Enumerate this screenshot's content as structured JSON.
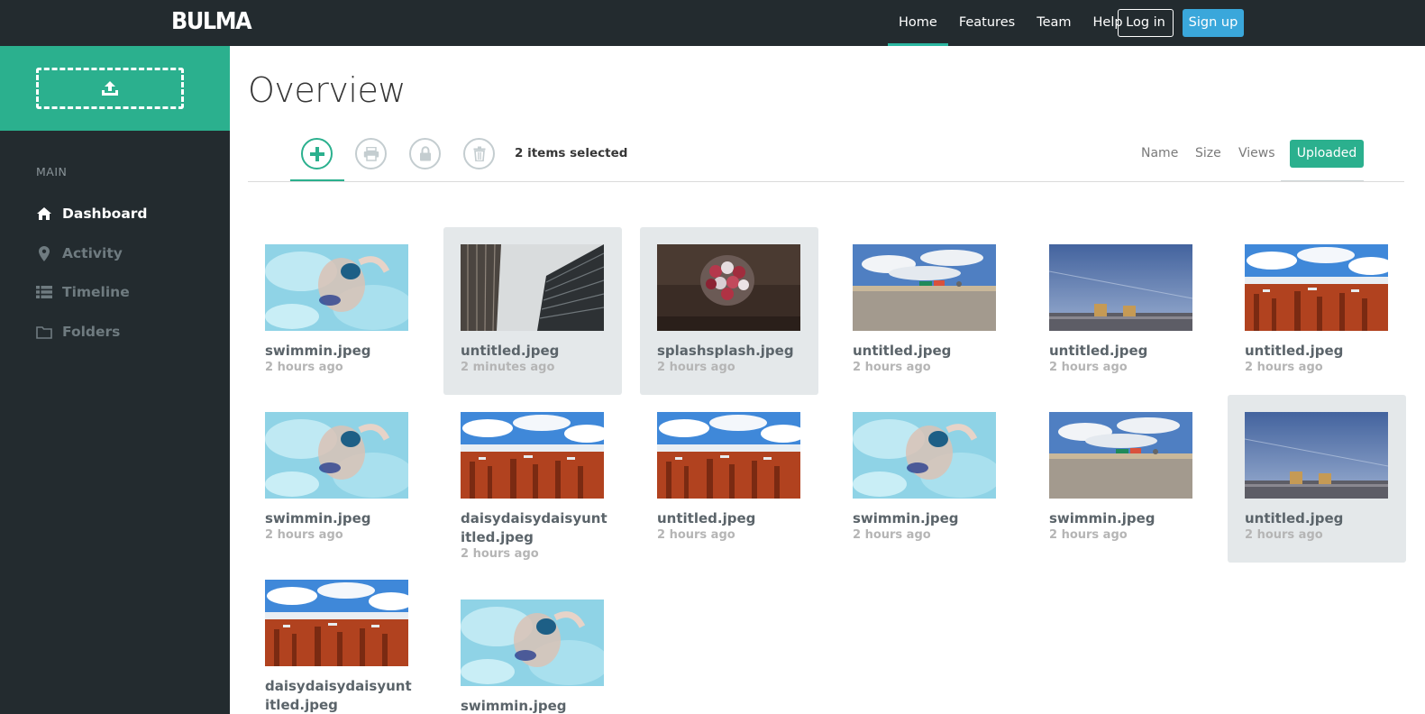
{
  "navbar": {
    "brand": "BULMA",
    "links": [
      "Home",
      "Features",
      "Team",
      "Help"
    ],
    "login_label": "Log in",
    "signup_label": "Sign up"
  },
  "sidebar": {
    "upload_icon": "upload-icon",
    "section_label": "MAIN",
    "items": [
      {
        "label": "Dashboard",
        "icon": "home-icon"
      },
      {
        "label": "Activity",
        "icon": "map-marker-icon"
      },
      {
        "label": "Timeline",
        "icon": "list-icon"
      },
      {
        "label": "Folders",
        "icon": "folder-icon"
      }
    ]
  },
  "main": {
    "title": "Overview",
    "toolbar": {
      "actions": [
        "plus-icon",
        "print-icon",
        "lock-icon",
        "trash-icon"
      ],
      "selected_text": "2 items selected"
    },
    "sort": {
      "options": [
        "Name",
        "Size",
        "Views"
      ],
      "active": "Uploaded"
    },
    "files": [
      {
        "name": "swimmin.jpeg",
        "time": "2 hours ago",
        "image": "swimmer",
        "selected": false
      },
      {
        "name": "untitled.jpeg",
        "time": "2 minutes ago",
        "image": "building",
        "selected": true
      },
      {
        "name": "splashsplash.jpeg",
        "time": "2 hours ago",
        "image": "candy",
        "selected": true
      },
      {
        "name": "untitled.jpeg",
        "time": "2 hours ago",
        "image": "desert",
        "selected": false
      },
      {
        "name": "untitled.jpeg",
        "time": "2 hours ago",
        "image": "dusk",
        "selected": false
      },
      {
        "name": "untitled.jpeg",
        "time": "2 hours ago",
        "image": "canyon",
        "selected": false
      },
      {
        "name": "swimmin.jpeg",
        "time": "2 hours ago",
        "image": "swimmer",
        "selected": false
      },
      {
        "name": "daisydaisydaisyuntitled.jpeg",
        "time": "2 hours ago",
        "image": "canyon",
        "selected": false
      },
      {
        "name": "untitled.jpeg",
        "time": "2 hours ago",
        "image": "canyon",
        "selected": false
      },
      {
        "name": "swimmin.jpeg",
        "time": "2 hours ago",
        "image": "swimmer",
        "selected": false
      },
      {
        "name": "swimmin.jpeg",
        "time": "2 hours ago",
        "image": "desert",
        "selected": false
      },
      {
        "name": "untitled.jpeg",
        "time": "2 hours ago",
        "image": "dusk",
        "selected": true
      },
      {
        "name": "daisydaisydaisyuntitled.jpeg",
        "time": "",
        "image": "canyon",
        "selected": false
      },
      {
        "name": "swimmin.jpeg",
        "time": "",
        "image": "swimmer",
        "selected": false
      }
    ]
  },
  "colors": {
    "navbar_bg": "#232b2f",
    "accent": "#2bb08e",
    "signup": "#3aa7db",
    "selected_card": "#e4e8ea"
  }
}
